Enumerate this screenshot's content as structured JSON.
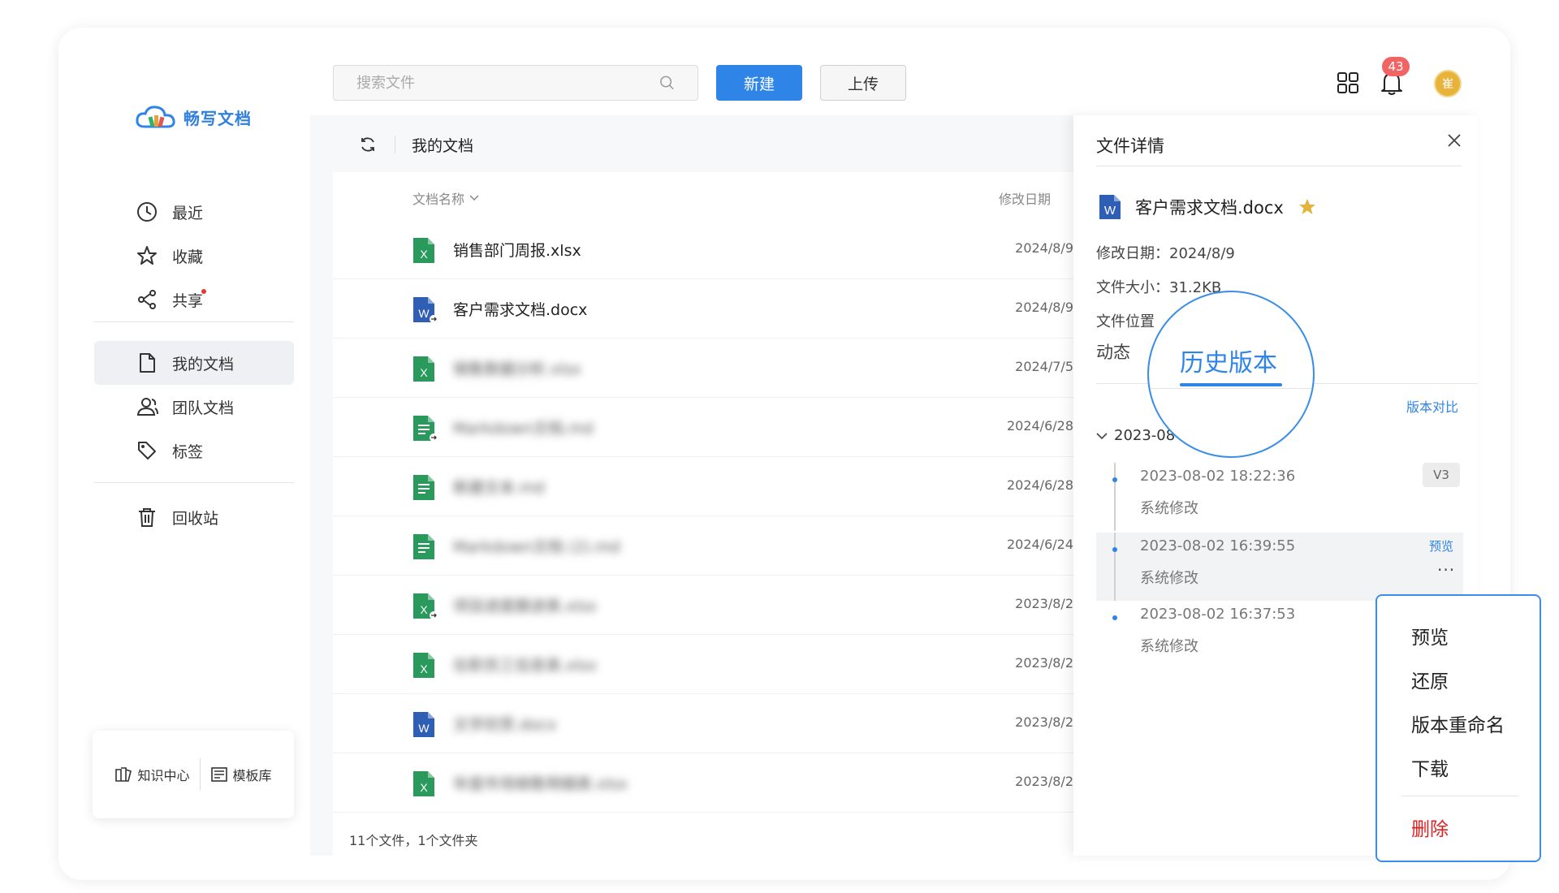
{
  "app": {
    "name": "畅写文档",
    "brand_color": "#2f84e8"
  },
  "sidebar": {
    "items": [
      {
        "label": "最近",
        "icon": "clock-icon"
      },
      {
        "label": "收藏",
        "icon": "star-icon"
      },
      {
        "label": "共享",
        "icon": "share-icon",
        "has_dot": true
      },
      {
        "label": "我的文档",
        "icon": "document-icon",
        "active": true
      },
      {
        "label": "团队文档",
        "icon": "team-icon"
      },
      {
        "label": "标签",
        "icon": "tag-icon"
      },
      {
        "label": "回收站",
        "icon": "trash-icon"
      }
    ],
    "bottom": {
      "knowledge": "知识中心",
      "templates": "模板库"
    }
  },
  "toolbar": {
    "search_placeholder": "搜索文件",
    "new_label": "新建",
    "upload_label": "上传",
    "notification_count": "43",
    "avatar_text": "崔"
  },
  "breadcrumb": {
    "current": "我的文档"
  },
  "file_list": {
    "col_name": "文档名称",
    "col_date": "修改日期",
    "rows": [
      {
        "name": "销售部门周报.xlsx",
        "type": "xlsx",
        "date": "2024/8/9",
        "blurred": false
      },
      {
        "name": "客户需求文档.docx",
        "type": "docx-shared",
        "date": "2024/8/9",
        "blurred": false
      },
      {
        "name": "销售数据分析.xlsx",
        "type": "xlsx",
        "date": "2024/7/5",
        "blurred": true
      },
      {
        "name": "Markdown文档.md",
        "type": "md-shared",
        "date": "2024/6/28",
        "blurred": true
      },
      {
        "name": "新建文本.md",
        "type": "md",
        "date": "2024/6/28",
        "blurred": true
      },
      {
        "name": "Markdown文档 (2).md",
        "type": "md",
        "date": "2024/6/24",
        "blurred": true
      },
      {
        "name": "项目进度跟进表.xlsx",
        "type": "xlsx-shared",
        "date": "2023/8/2",
        "blurred": true
      },
      {
        "name": "在职员工信息表.xlsx",
        "type": "xlsx",
        "date": "2023/8/2",
        "blurred": true
      },
      {
        "name": "文学欣赏.docx",
        "type": "docx",
        "date": "2023/8/2",
        "blurred": true
      },
      {
        "name": "年度市场销售明细表.xlsx",
        "type": "xlsx",
        "date": "2023/8/2",
        "blurred": true
      }
    ],
    "footer": "11个文件，1个文件夹"
  },
  "details": {
    "title": "文件详情",
    "file_name": "客户需求文档.docx",
    "modified": "修改日期：2024/8/9",
    "size": "文件大小：31.2KB",
    "location": "文件位置",
    "tab_activity": "动态",
    "tab_history": "历史版本",
    "compare": "版本对比",
    "group": "2023-08",
    "versions": [
      {
        "time": "2023-08-02 18:22:36",
        "note": "系统修改",
        "tag": "V3"
      },
      {
        "time": "2023-08-02 16:39:55",
        "note": "系统修改",
        "preview": "预览",
        "more": "···"
      },
      {
        "time": "2023-08-02 16:37:53",
        "note": "系统修改"
      }
    ]
  },
  "context_menu": {
    "items": [
      "预览",
      "还原",
      "版本重命名",
      "下载"
    ],
    "danger": "删除"
  }
}
